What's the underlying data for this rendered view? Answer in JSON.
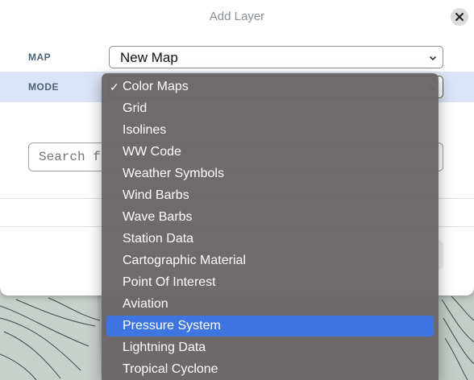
{
  "modal": {
    "title": "Add Layer",
    "map_label": "MAP",
    "map_value": "New Map",
    "mode_label": "MODE",
    "search_placeholder": "Search f"
  },
  "dropdown": {
    "options": [
      {
        "label": "Color Maps",
        "checked": true
      },
      {
        "label": "Grid"
      },
      {
        "label": "Isolines"
      },
      {
        "label": "WW Code"
      },
      {
        "label": "Weather Symbols"
      },
      {
        "label": "Wind Barbs"
      },
      {
        "label": "Wave Barbs"
      },
      {
        "label": "Station Data"
      },
      {
        "label": "Cartographic Material"
      },
      {
        "label": "Point Of Interest"
      },
      {
        "label": "Aviation"
      },
      {
        "label": "Pressure System",
        "highlighted": true
      },
      {
        "label": "Lightning Data"
      },
      {
        "label": "Tropical Cyclone"
      }
    ],
    "check_mark": "✓"
  },
  "colors": {
    "highlight": "#3f75e0",
    "mode_row": "#d9e4f7",
    "dropdown_bg": "#6a6566"
  }
}
